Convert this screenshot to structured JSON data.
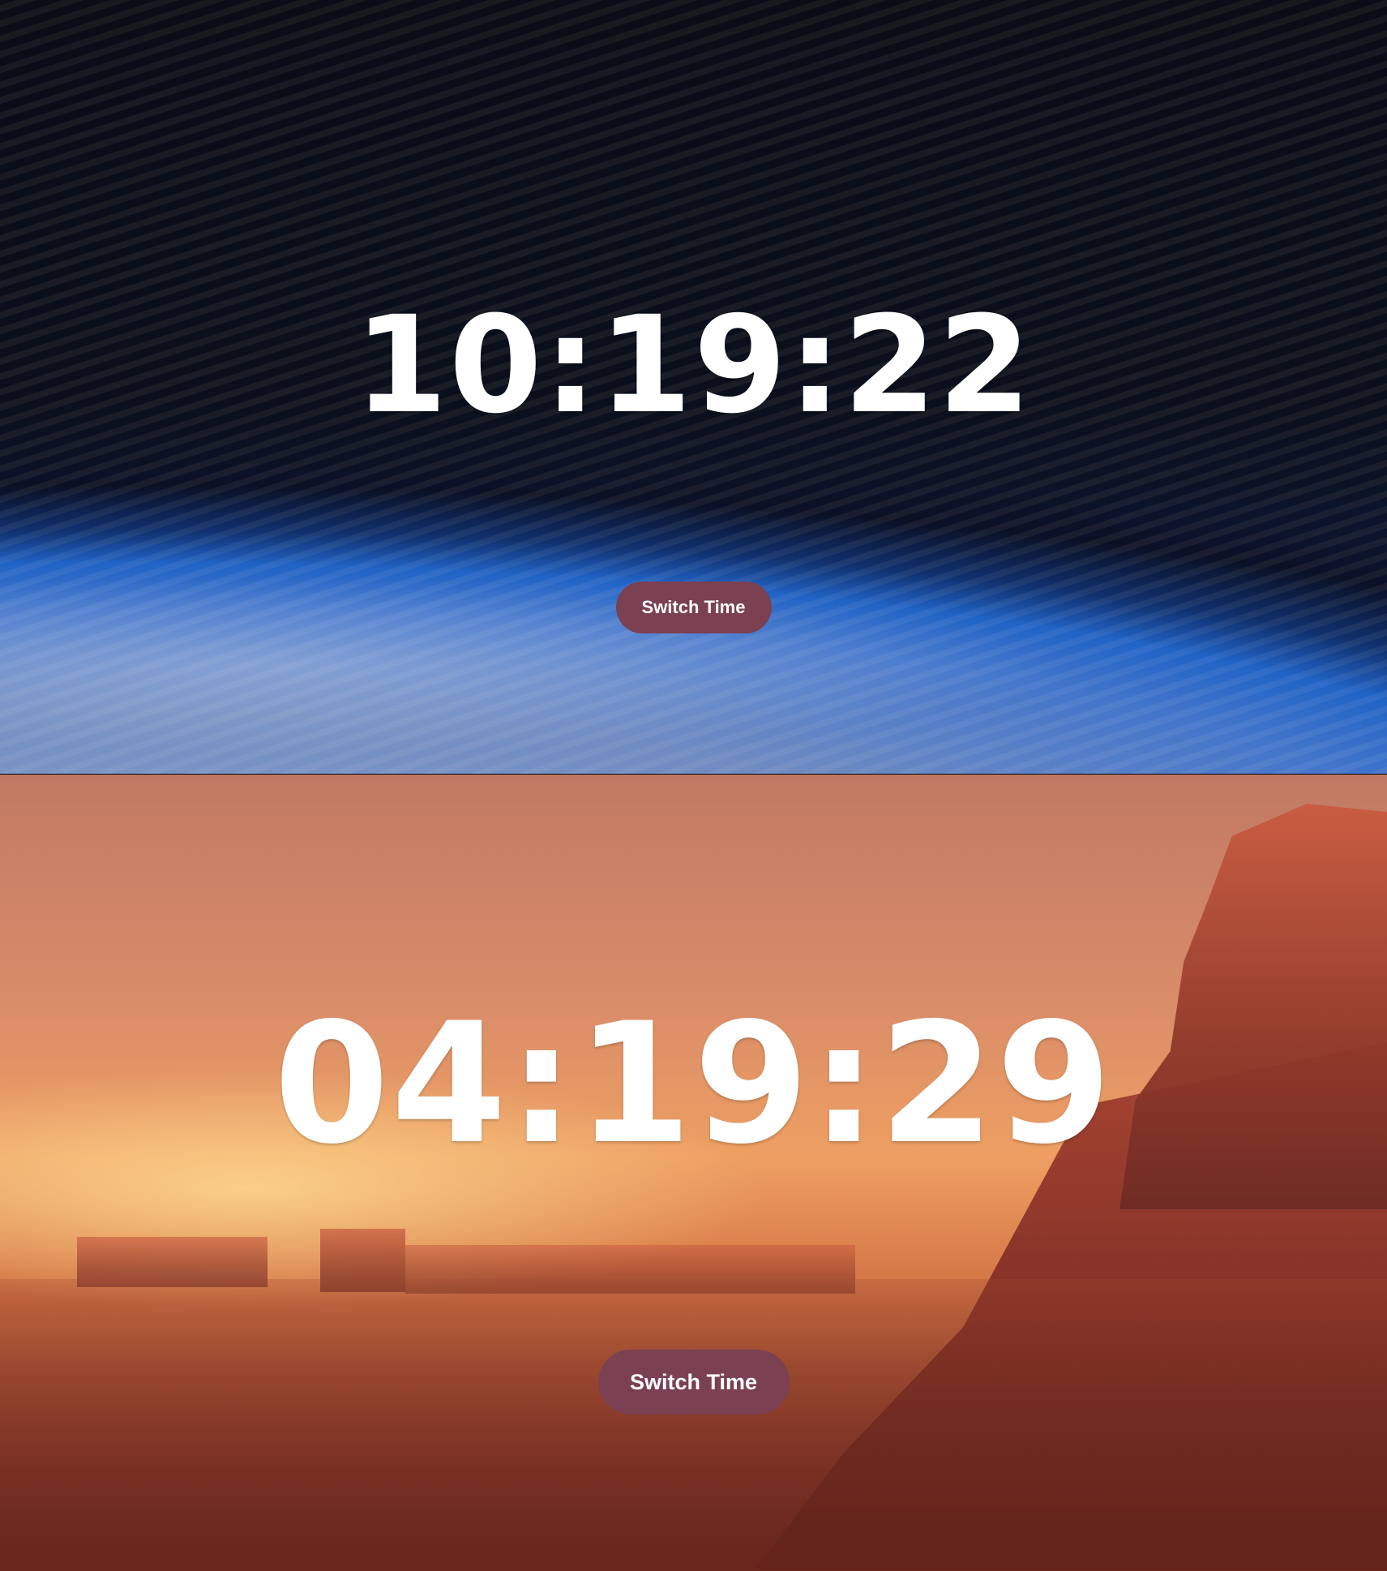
{
  "panels": [
    {
      "time": "10:19:22",
      "button_label": "Switch Time"
    },
    {
      "time": "04:19:29",
      "button_label": "Switch Time"
    }
  ],
  "colors": {
    "button_background": "#7b4052",
    "text": "#ffffff"
  }
}
